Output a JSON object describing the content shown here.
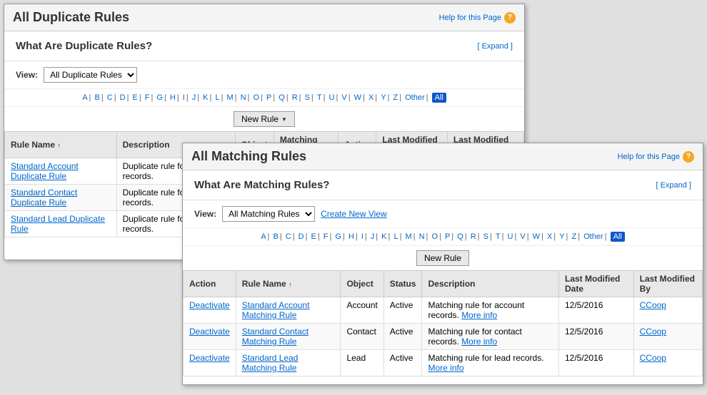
{
  "duplicate_panel": {
    "title": "All Duplicate Rules",
    "help_text": "Help for this Page",
    "what_are_title": "What Are Duplicate Rules?",
    "expand_label": "[ Expand ]",
    "view_label": "View:",
    "view_option": "All Duplicate Rules",
    "alpha_letters": [
      "A",
      "B",
      "C",
      "D",
      "E",
      "F",
      "G",
      "H",
      "I",
      "J",
      "K",
      "L",
      "M",
      "N",
      "O",
      "P",
      "Q",
      "R",
      "S",
      "T",
      "U",
      "V",
      "W",
      "X",
      "Y",
      "Z",
      "Other",
      "All"
    ],
    "new_rule_btn": "New Rule",
    "columns": [
      "Rule Name",
      "Description",
      "Object",
      "Matching Rule",
      "Active",
      "Last Modified By",
      "Last Modified Date"
    ],
    "rows": [
      {
        "name": "Standard Account Duplicate Rule",
        "description": "Duplicate rule for account records.",
        "object": "",
        "matching_rule": "",
        "active": "",
        "last_modified_by": "",
        "last_modified_date": ""
      },
      {
        "name": "Standard Contact Duplicate Rule",
        "description": "Duplicate rule for contact records.",
        "object": "",
        "matching_rule": "",
        "active": "",
        "last_modified_by": "",
        "last_modified_date": ""
      },
      {
        "name": "Standard Lead Duplicate Rule",
        "description": "Duplicate rule for lead records.",
        "object": "",
        "matching_rule": "",
        "active": "",
        "last_modified_by": "",
        "last_modified_date": ""
      }
    ]
  },
  "matching_panel": {
    "title": "All Matching Rules",
    "help_text": "Help for this Page",
    "what_are_title": "What Are Matching Rules?",
    "expand_label": "[ Expand ]",
    "view_label": "View:",
    "view_option": "All Matching Rules",
    "create_new_view": "Create New View",
    "alpha_letters": [
      "A",
      "B",
      "C",
      "D",
      "E",
      "F",
      "G",
      "H",
      "I",
      "J",
      "K",
      "L",
      "M",
      "N",
      "O",
      "P",
      "Q",
      "R",
      "S",
      "T",
      "U",
      "V",
      "W",
      "X",
      "Y",
      "Z",
      "Other",
      "All"
    ],
    "new_rule_btn": "New Rule",
    "columns": [
      "Action",
      "Rule Name",
      "Object",
      "Status",
      "Description",
      "Last Modified Date",
      "Last Modified By"
    ],
    "rows": [
      {
        "action": "Deactivate",
        "name": "Standard Account Matching Rule",
        "object": "Account",
        "status": "Active",
        "description": "Matching rule for account records.",
        "more_info": "More info",
        "last_modified_date": "12/5/2016",
        "last_modified_by": "CCoop"
      },
      {
        "action": "Deactivate",
        "name": "Standard Contact Matching Rule",
        "object": "Contact",
        "status": "Active",
        "description": "Matching rule for contact records.",
        "more_info": "More info",
        "last_modified_date": "12/5/2016",
        "last_modified_by": "CCoop"
      },
      {
        "action": "Deactivate",
        "name": "Standard Lead Matching Rule",
        "object": "Lead",
        "status": "Active",
        "description": "Matching rule for lead records.",
        "more_info": "More info",
        "last_modified_date": "12/5/2016",
        "last_modified_by": "CCoop"
      }
    ]
  }
}
